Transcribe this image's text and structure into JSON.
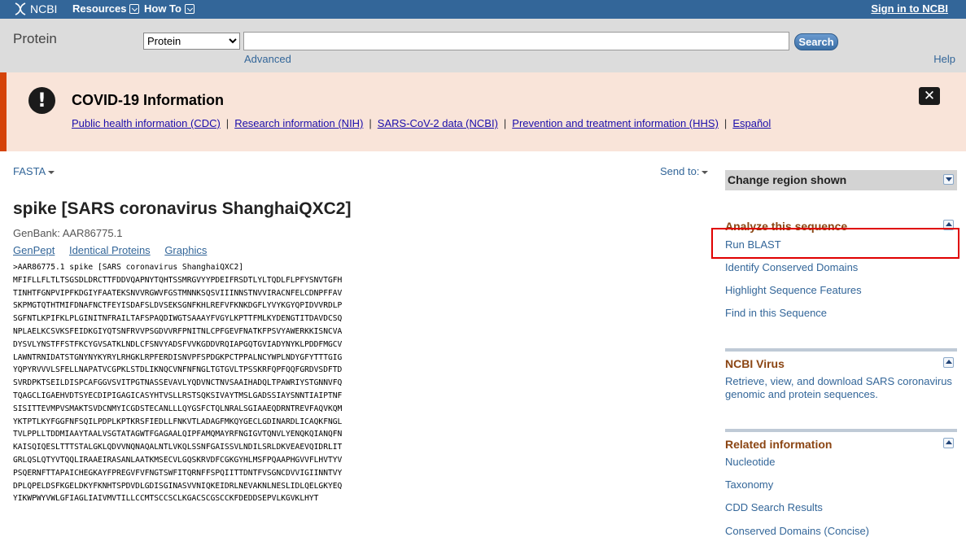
{
  "topbar": {
    "brand": "NCBI",
    "resources_label": "Resources",
    "howto_label": "How To",
    "signin_label": "Sign in to NCBI"
  },
  "search": {
    "db_title": "Protein",
    "db_selected": "Protein",
    "term_value": "",
    "search_label": "Search",
    "advanced_label": "Advanced",
    "help_label": "Help"
  },
  "covid": {
    "title": "COVID-19 Information",
    "links": [
      "Public health information (CDC)",
      "Research information (NIH)",
      "SARS-CoV-2 data (NCBI)",
      "Prevention and treatment information (HHS)",
      "Español"
    ],
    "separator": "|"
  },
  "record": {
    "format_label": "FASTA",
    "sendto_label": "Send to:",
    "title": "spike [SARS coronavirus ShanghaiQXC2]",
    "genbank": "GenBank: AAR86775.1",
    "links": [
      "GenPept",
      "Identical Proteins",
      "Graphics"
    ],
    "fasta": ">AAR86775.1 spike [SARS coronavirus ShanghaiQXC2]\nMFIFLLFLTLTSGSDLDRCTTFDDVQAPNYTQHTSSMRGVYYPDEIFRSDTLYLTQDLFLPFYSNVTGFH\nTINHTFGNPVIPFKDGIYFAATEKSNVVRGWVFGSTMNNKSQSVIIINNSTNVVIRACNFELCDNPFFAV\nSKPMGTQTHTMIFDNAFNCTFEYISDAFSLDVSEKSGNFKHLREFVFKNKDGFLYVYKGYQPIDVVRDLP\nSGFNTLKPIFKLPLGINITNFRAILTAFSPAQDIWGTSAAAYFVGYLKPTTFMLKYDENGTITDAVDCSQ\nNPLAELKCSVKSFEIDKGIYQTSNFRVVPSGDVVRFPNITNLCPFGEVFNATKFPSVYAWERKKISNCVA\nDYSVLYNSTFFSTFKCYGVSATKLNDLCFSNVYADSFVVKGDDVRQIAPGQTGVIADYNYKLPDDFMGCV\nLAWNTRNIDATSTGNYNYKYRYLRHGKLRPFERDISNVPFSPDGKPCTPPALNCYWPLNDYGFYTTTGIG\nYQPYRVVVLSFELLNAPATVCGPKLSTDLIKNQCVNFNFNGLTGTGVLTPSSKRFQPFQQFGRDVSDFTD\nSVRDPKTSEILDISPCAFGGVSVITPGTNASSEVAVLYQDVNCTNVSAAIHADQLTPAWRIYSTGNNVFQ\nTQAGCLIGAEHVDTSYECDIPIGAGICASYHTVSLLRSTSQKSIVAYTMSLGADSSIAYSNNTIAIPTNF\nSISITTEVMPVSMAKTSVDCNMYICGDSTECANLLLQYGSFCTQLNRALSGIAAEQDRNTREVFAQVKQM\nYKTPTLKYFGGFNFSQILPDPLKPTKRSFIEDLLFNKVTLADAGFMKQYGECLGDINARDLICAQKFNGL\nTVLPPLLTDDMIAAYTAALVSGTATAGWTFGAGAALQIPFAMQMAYRFNGIGVTQNVLYENQKQIANQFN\nKAISQIQESLTTTSTALGKLQDVVNQNAQALNTLVKQLSSNFGAISSVLNDILSRLDKVEAEVQIDRLIT\nGRLQSLQTYVTQQLIRAAEIRASANLAATKMSECVLGQSKRVDFCGKGYHLMSFPQAAPHGVVFLHVTYV\nPSQERNFTTAPAICHEGKAYFPREGVFVFNGTSWFITQRNFFSPQIITTDNTFVSGNCDVVIGIINNTVY\nDPLQPELDSFKGELDKYFKNHTSPDVDLGDISGINASVVNIQKEIDRLNEVAKNLNESLIDLQELGKYEQ\nYIKWPWYVWLGFIAGLIAIVMVTILLCCMTSCCSCLKGACSCGSCCKFDEDDSEPVLKGVKLHYT"
  },
  "sidebar": {
    "region_label": "Change region shown",
    "analyze": {
      "heading": "Analyze this sequence",
      "items": [
        "Run BLAST",
        "Identify Conserved Domains",
        "Highlight Sequence Features",
        "Find in this Sequence"
      ]
    },
    "virus": {
      "heading": "NCBI Virus",
      "text": "Retrieve, view, and download SARS coronavirus genomic and protein sequences."
    },
    "related": {
      "heading": "Related information",
      "items": [
        "Nucleotide",
        "Taxonomy",
        "CDD Search Results",
        "Conserved Domains (Concise)"
      ]
    }
  },
  "colors": {
    "topbar": "#336699",
    "banner_bg": "#f9e4d9",
    "banner_accent": "#d54309",
    "highlight": "#e00000"
  }
}
